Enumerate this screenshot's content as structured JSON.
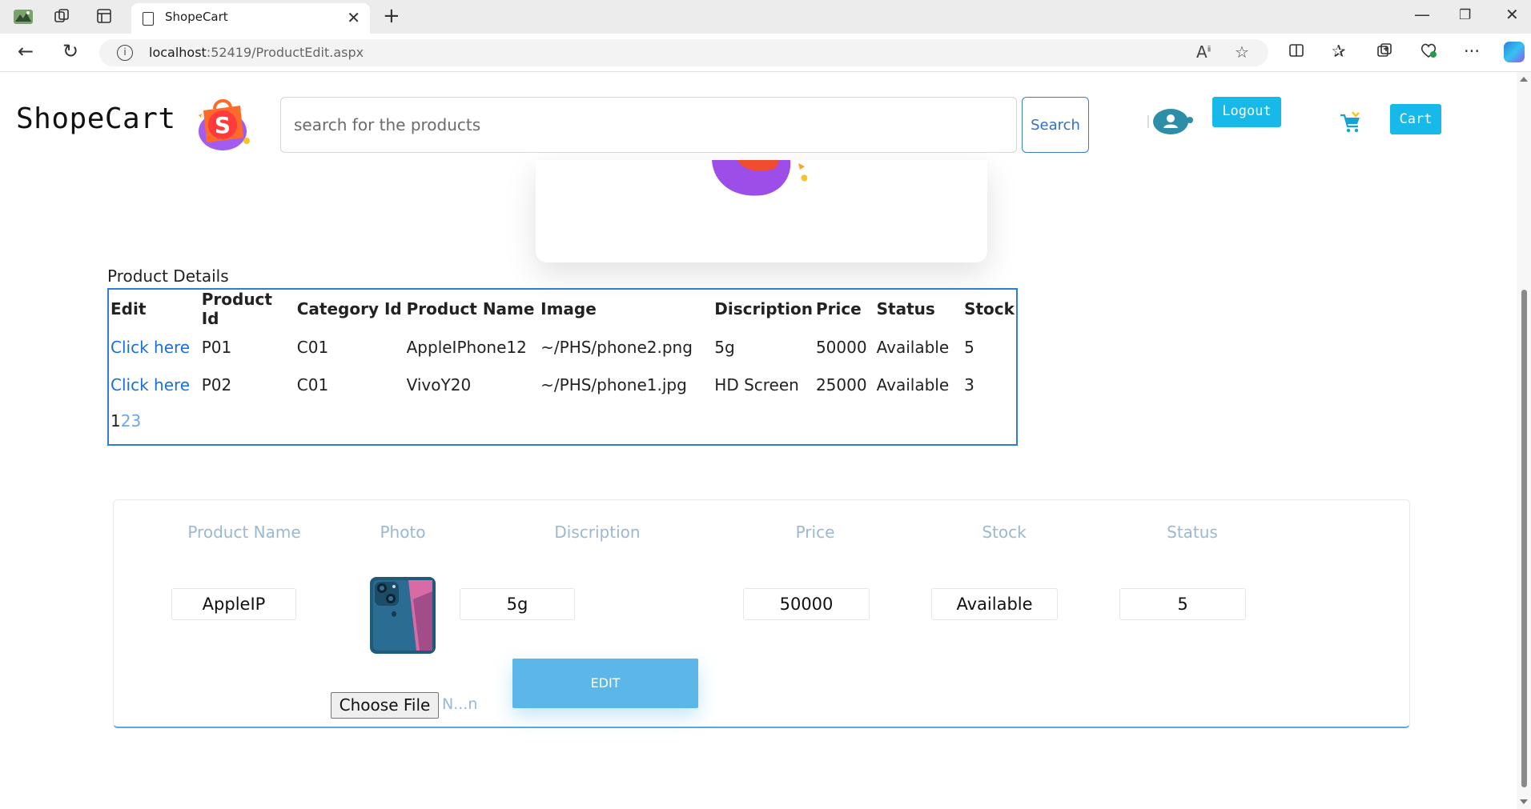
{
  "browser": {
    "tab_title": "ShopeCart",
    "url_host": "localhost",
    "url_path": ":52419/ProductEdit.aspx"
  },
  "header": {
    "brand": "ShopeCart",
    "search_placeholder": "search for the products",
    "search_label": "Search",
    "logout_label": "Logout",
    "cart_label": "Cart"
  },
  "product_details": {
    "caption": "Product Details",
    "columns": [
      "Edit",
      "Product Id",
      "Category Id",
      "Product Name",
      "Image",
      "Discription",
      "Price",
      "Status",
      "Stock"
    ],
    "rows": [
      [
        "Click here",
        "P01",
        "C01",
        "AppleIPhone12",
        "~/PHS/phone2.png",
        "5g",
        "50000",
        "Available",
        "5"
      ],
      [
        "Click here",
        "P02",
        "C01",
        "VivoY20",
        "~/PHS/phone1.jpg",
        "HD Screen",
        "25000",
        "Available",
        "3"
      ]
    ],
    "pager": {
      "current": "1",
      "pages": [
        "2",
        "3"
      ]
    }
  },
  "edit_form": {
    "headers": {
      "name": "Product Name",
      "photo": "Photo",
      "description": "Discription",
      "price": "Price",
      "stock": "Stock",
      "status": "Status"
    },
    "values": {
      "name": "AppleIP",
      "description": "5g",
      "price": "50000",
      "stock": "Available",
      "status": "5"
    },
    "choose_file_label": "Choose File",
    "no_file_text": "N...n",
    "edit_label": "EDIT"
  },
  "colors": {
    "accent": "#17b9e8",
    "link": "#1a6fd8",
    "table_border": "#2f7fd0",
    "edit_button": "#5ab7e7",
    "form_header": "#9bb8d3"
  }
}
